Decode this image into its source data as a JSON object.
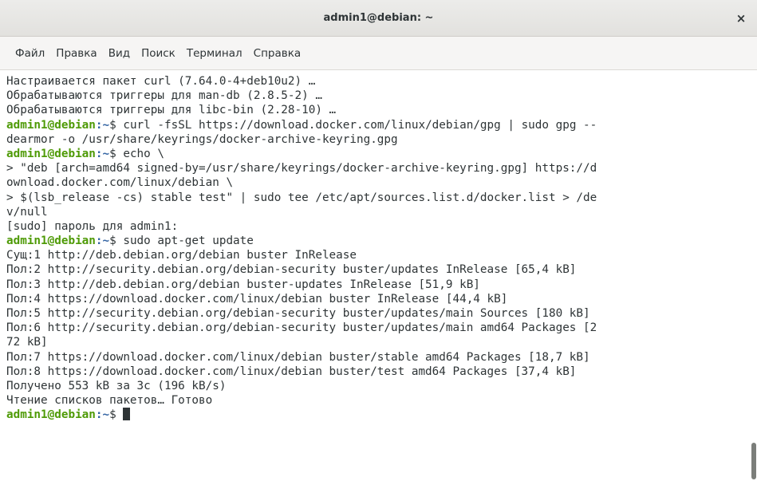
{
  "window": {
    "title": "admin1@debian: ~",
    "close_glyph": "×"
  },
  "menu": [
    "Файл",
    "Правка",
    "Вид",
    "Поиск",
    "Терминал",
    "Справка"
  ],
  "prompt": {
    "user": "admin1@debian",
    "path": ":~"
  },
  "terminal_lines": [
    {
      "text": "Настраивается пакет curl (7.64.0-4+deb10u2) …"
    },
    {
      "text": "Обрабатываются триггеры для man-db (2.8.5-2) …"
    },
    {
      "text": "Обрабатываются триггеры для libc-bin (2.28-10) …"
    },
    {
      "prompt": true,
      "text": "$ curl -fsSL https://download.docker.com/linux/debian/gpg | sudo gpg --"
    },
    {
      "text": "dearmor -o /usr/share/keyrings/docker-archive-keyring.gpg"
    },
    {
      "prompt": true,
      "text": "$ echo \\"
    },
    {
      "text": "> \"deb [arch=amd64 signed-by=/usr/share/keyrings/docker-archive-keyring.gpg] https://d"
    },
    {
      "text": "ownload.docker.com/linux/debian \\"
    },
    {
      "text": "> $(lsb_release -cs) stable test\" | sudo tee /etc/apt/sources.list.d/docker.list > /de"
    },
    {
      "text": "v/null"
    },
    {
      "text": "[sudo] пароль для admin1:"
    },
    {
      "prompt": true,
      "text": "$ sudo apt-get update"
    },
    {
      "text": "Сущ:1 http://deb.debian.org/debian buster InRelease"
    },
    {
      "text": "Пол:2 http://security.debian.org/debian-security buster/updates InRelease [65,4 kB]"
    },
    {
      "text": "Пол:3 http://deb.debian.org/debian buster-updates InRelease [51,9 kB]"
    },
    {
      "text": "Пол:4 https://download.docker.com/linux/debian buster InRelease [44,4 kB]"
    },
    {
      "text": "Пол:5 http://security.debian.org/debian-security buster/updates/main Sources [180 kB]"
    },
    {
      "text": "Пол:6 http://security.debian.org/debian-security buster/updates/main amd64 Packages [2"
    },
    {
      "text": "72 kB]"
    },
    {
      "text": "Пол:7 https://download.docker.com/linux/debian buster/stable amd64 Packages [18,7 kB]"
    },
    {
      "text": "Пол:8 https://download.docker.com/linux/debian buster/test amd64 Packages [37,4 kB]"
    },
    {
      "text": "Получено 553 kB за 3с (196 kB/s)"
    },
    {
      "text": "Чтение списков пакетов… Готово"
    },
    {
      "prompt": true,
      "text": "$ ",
      "cursor": true
    }
  ]
}
